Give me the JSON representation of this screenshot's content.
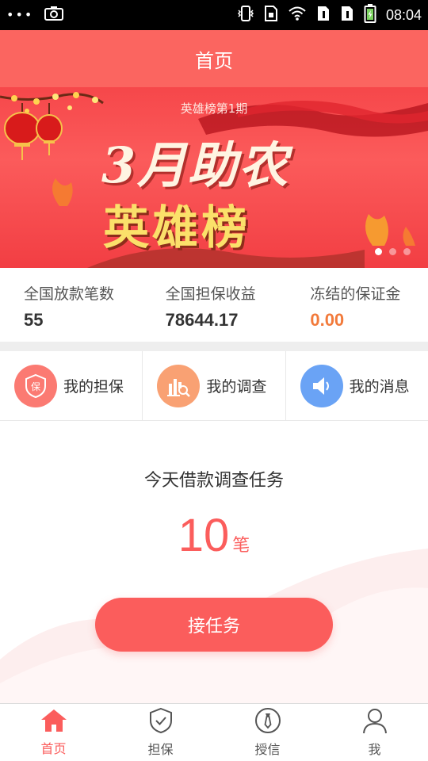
{
  "status_bar": {
    "dots": "•••",
    "time": "08:04",
    "icons": [
      "screenshot-icon",
      "vibrate-icon",
      "sim-icon",
      "wifi-icon",
      "sim1-icon",
      "sim2-icon",
      "battery-icon"
    ]
  },
  "header": {
    "title": "首页"
  },
  "banner": {
    "subtitle": "英雄榜第1期",
    "headline_line1": "3月助农",
    "headline_line2": "英雄榜",
    "page_count": 3,
    "active_page": 1
  },
  "stats": [
    {
      "label": "全国放款笔数",
      "value": "55"
    },
    {
      "label": "全国担保收益",
      "value": "78644.17"
    },
    {
      "label": "冻结的保证金",
      "value": "0.00"
    }
  ],
  "quick_entries": [
    {
      "label": "我的担保",
      "icon": "shield-bao-icon",
      "color": "#fb7a72",
      "icon_text": "保"
    },
    {
      "label": "我的调查",
      "icon": "chart-search-icon",
      "color": "#f9a173"
    },
    {
      "label": "我的消息",
      "icon": "speaker-icon",
      "color": "#6aa3f5"
    }
  ],
  "task": {
    "title": "今天借款调查任务",
    "count": "10",
    "unit": "笔",
    "button_label": "接任务"
  },
  "tabbar": {
    "items": [
      {
        "label": "首页",
        "icon": "home-icon",
        "active": true
      },
      {
        "label": "担保",
        "icon": "shield-check-icon",
        "active": false
      },
      {
        "label": "授信",
        "icon": "tie-icon",
        "active": false
      },
      {
        "label": "我",
        "icon": "user-icon",
        "active": false
      }
    ]
  },
  "colors": {
    "brand": "#fb5d5c",
    "header": "#fb6560",
    "frozen_value": "#f27a3b"
  }
}
